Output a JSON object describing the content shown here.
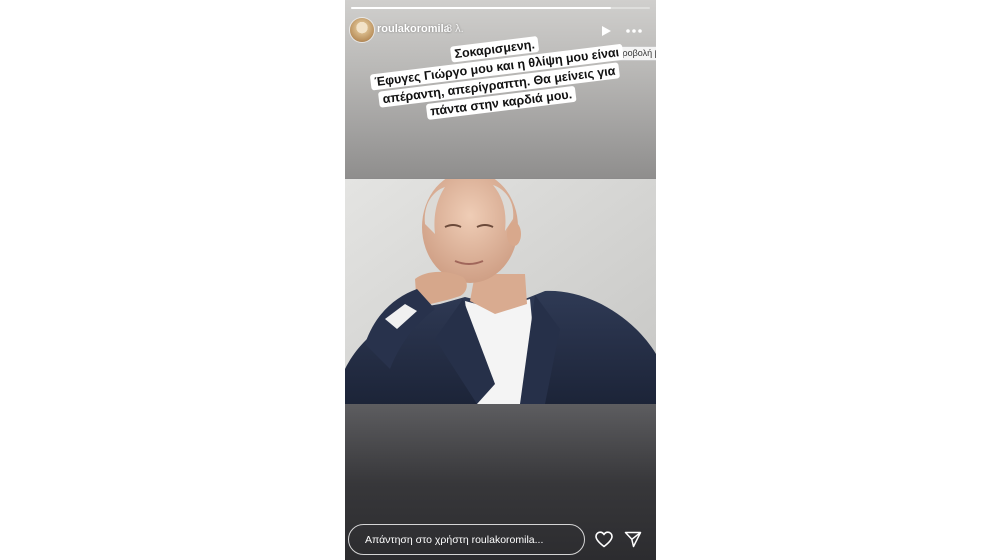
{
  "story": {
    "progress_fraction": 0.87,
    "username": "roulakoromila",
    "time_ago": "8 λ.",
    "tooltip": "Προβολή β",
    "caption_lines": [
      "Σοκαρισμενη.",
      "Έφυγες Γιώργο μου και η θλίψη μου είναι",
      "απέραντη, απερίγραπτη. Θα μείνεις για",
      "πάντα στην καρδιά μου."
    ],
    "reply_placeholder": "Απάντηση στο χρήστη roulakoromila..."
  },
  "icons": {
    "avatar": "avatar",
    "play": "play-icon",
    "more": "more-icon",
    "heart": "heart-icon",
    "send": "send-icon"
  },
  "colors": {
    "story_top": "#d0cfcd",
    "story_bottom": "#2c2c2f",
    "text_white": "#ffffff",
    "caption_bg": "#ffffff"
  }
}
